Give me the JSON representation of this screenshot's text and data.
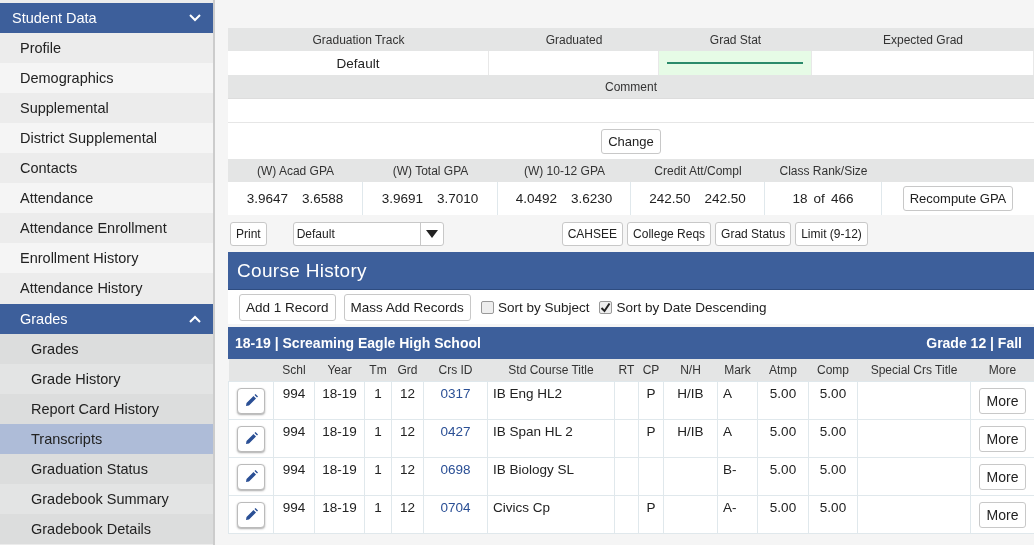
{
  "sidebar": {
    "title": "Student Data",
    "expanded": true,
    "items": [
      {
        "label": "Profile",
        "selected": false
      },
      {
        "label": "Demographics",
        "selected": false
      },
      {
        "label": "Supplemental",
        "selected": false
      },
      {
        "label": "District Supplemental",
        "selected": false
      },
      {
        "label": "Contacts",
        "selected": false
      },
      {
        "label": "Attendance",
        "selected": false
      },
      {
        "label": "Attendance Enrollment",
        "selected": false
      },
      {
        "label": "Enrollment History",
        "selected": false
      },
      {
        "label": "Attendance History",
        "selected": false
      },
      {
        "label": "Grades",
        "expanded": true,
        "children": [
          {
            "label": "Grades",
            "selected": false
          },
          {
            "label": "Grade History",
            "selected": false
          },
          {
            "label": "Report Card History",
            "selected": false
          },
          {
            "label": "Transcripts",
            "selected": true
          },
          {
            "label": "Graduation Status",
            "selected": false
          },
          {
            "label": "Gradebook Summary",
            "selected": false
          },
          {
            "label": "Gradebook Details",
            "selected": false
          }
        ]
      }
    ]
  },
  "graduation": {
    "fields": [
      {
        "label": "Graduation Track",
        "value": "Default"
      },
      {
        "label": "Graduated"
      },
      {
        "label": "Grad Stat",
        "kind": "select"
      },
      {
        "label": "Expected Grad"
      }
    ],
    "comment": {
      "label": "Comment"
    },
    "change_button": "Change"
  },
  "gpa": {
    "columns": [
      {
        "label": "(W) Acad GPA",
        "values": [
          "3.9647",
          "3.6588"
        ]
      },
      {
        "label": "(W) Total GPA",
        "values": [
          "3.9691",
          "3.7010"
        ]
      },
      {
        "label": "(W) 10-12 GPA",
        "values": [
          "4.0492",
          "3.6230"
        ]
      },
      {
        "label": "Credit Att/Compl",
        "values": [
          "242.50",
          "242.50"
        ]
      },
      {
        "label": "Class Rank/Size",
        "values": [
          "18",
          "of",
          "466"
        ]
      }
    ],
    "recompute_button": "Recompute GPA"
  },
  "toolbar": {
    "print_button": "Print",
    "track_select": {
      "value": "Default"
    },
    "buttons": [
      "CAHSEE",
      "College Reqs",
      "Grad Status",
      "Limit (9-12)"
    ]
  },
  "course_history": {
    "title": "Course History",
    "buttons": [
      "Add 1 Record",
      "Mass Add Records"
    ],
    "checkboxes": [
      {
        "label": "Sort by Subject",
        "checked": false
      },
      {
        "label": "Sort by Date Descending",
        "checked": true
      }
    ],
    "school_bar": {
      "left": "18-19 | Screaming Eagle High School",
      "right": "Grade 12 | Fall"
    },
    "columns": [
      "Schl",
      "Year",
      "Tm",
      "Grd",
      "Crs ID",
      "Std Course Title",
      "RT",
      "CP",
      "N/H",
      "Mark",
      "Atmp",
      "Comp",
      "Special Crs Title",
      "More"
    ],
    "rows": [
      {
        "cells": [
          "994",
          "18-19",
          "1",
          "12",
          "0317",
          "IB Eng HL2",
          "",
          "P",
          "H/IB",
          "A",
          "5.00",
          "5.00",
          ""
        ],
        "more": "More"
      },
      {
        "cells": [
          "994",
          "18-19",
          "1",
          "12",
          "0427",
          "IB Span HL 2",
          "",
          "P",
          "H/IB",
          "A",
          "5.00",
          "5.00",
          ""
        ],
        "more": "More"
      },
      {
        "cells": [
          "994",
          "18-19",
          "1",
          "12",
          "0698",
          "IB Biology SL",
          "",
          "",
          "",
          "B-",
          "5.00",
          "5.00",
          ""
        ],
        "more": "More"
      },
      {
        "cells": [
          "994",
          "18-19",
          "1",
          "12",
          "0704",
          "Civics Cp",
          "",
          "P",
          "",
          "A-",
          "5.00",
          "5.00",
          ""
        ],
        "more": "More"
      }
    ]
  }
}
